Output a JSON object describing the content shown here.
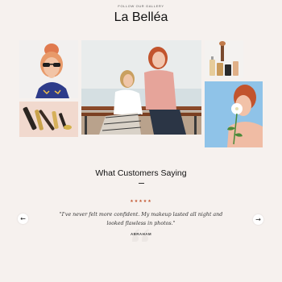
{
  "gallery": {
    "eyebrow": "FOLLOW OUR GALLERY",
    "title": "La Belléa",
    "tiles": [
      {
        "label": "Woman with sunglasses and bun hairstyle"
      },
      {
        "label": "Makeup brushes and lipsticks on pink background"
      },
      {
        "label": "Two women sitting on a bench by the sea"
      },
      {
        "label": "Cosmetic bottles and brushes"
      },
      {
        "label": "Red-haired woman with white flower"
      }
    ]
  },
  "testimonials": {
    "heading": "What Customers Saying",
    "stars": "★★★★★",
    "rating": 5,
    "quote": "\"I've never felt more confident. My makeup lasted all night and looked flawless in photos.\"",
    "author": "ABRAHAM",
    "prev_icon": "arrow-left-icon",
    "next_icon": "arrow-right-icon",
    "prev_glyph": "←",
    "next_glyph": "→"
  },
  "colors": {
    "background": "#f6f1ee",
    "accent_star": "#c2542d"
  }
}
